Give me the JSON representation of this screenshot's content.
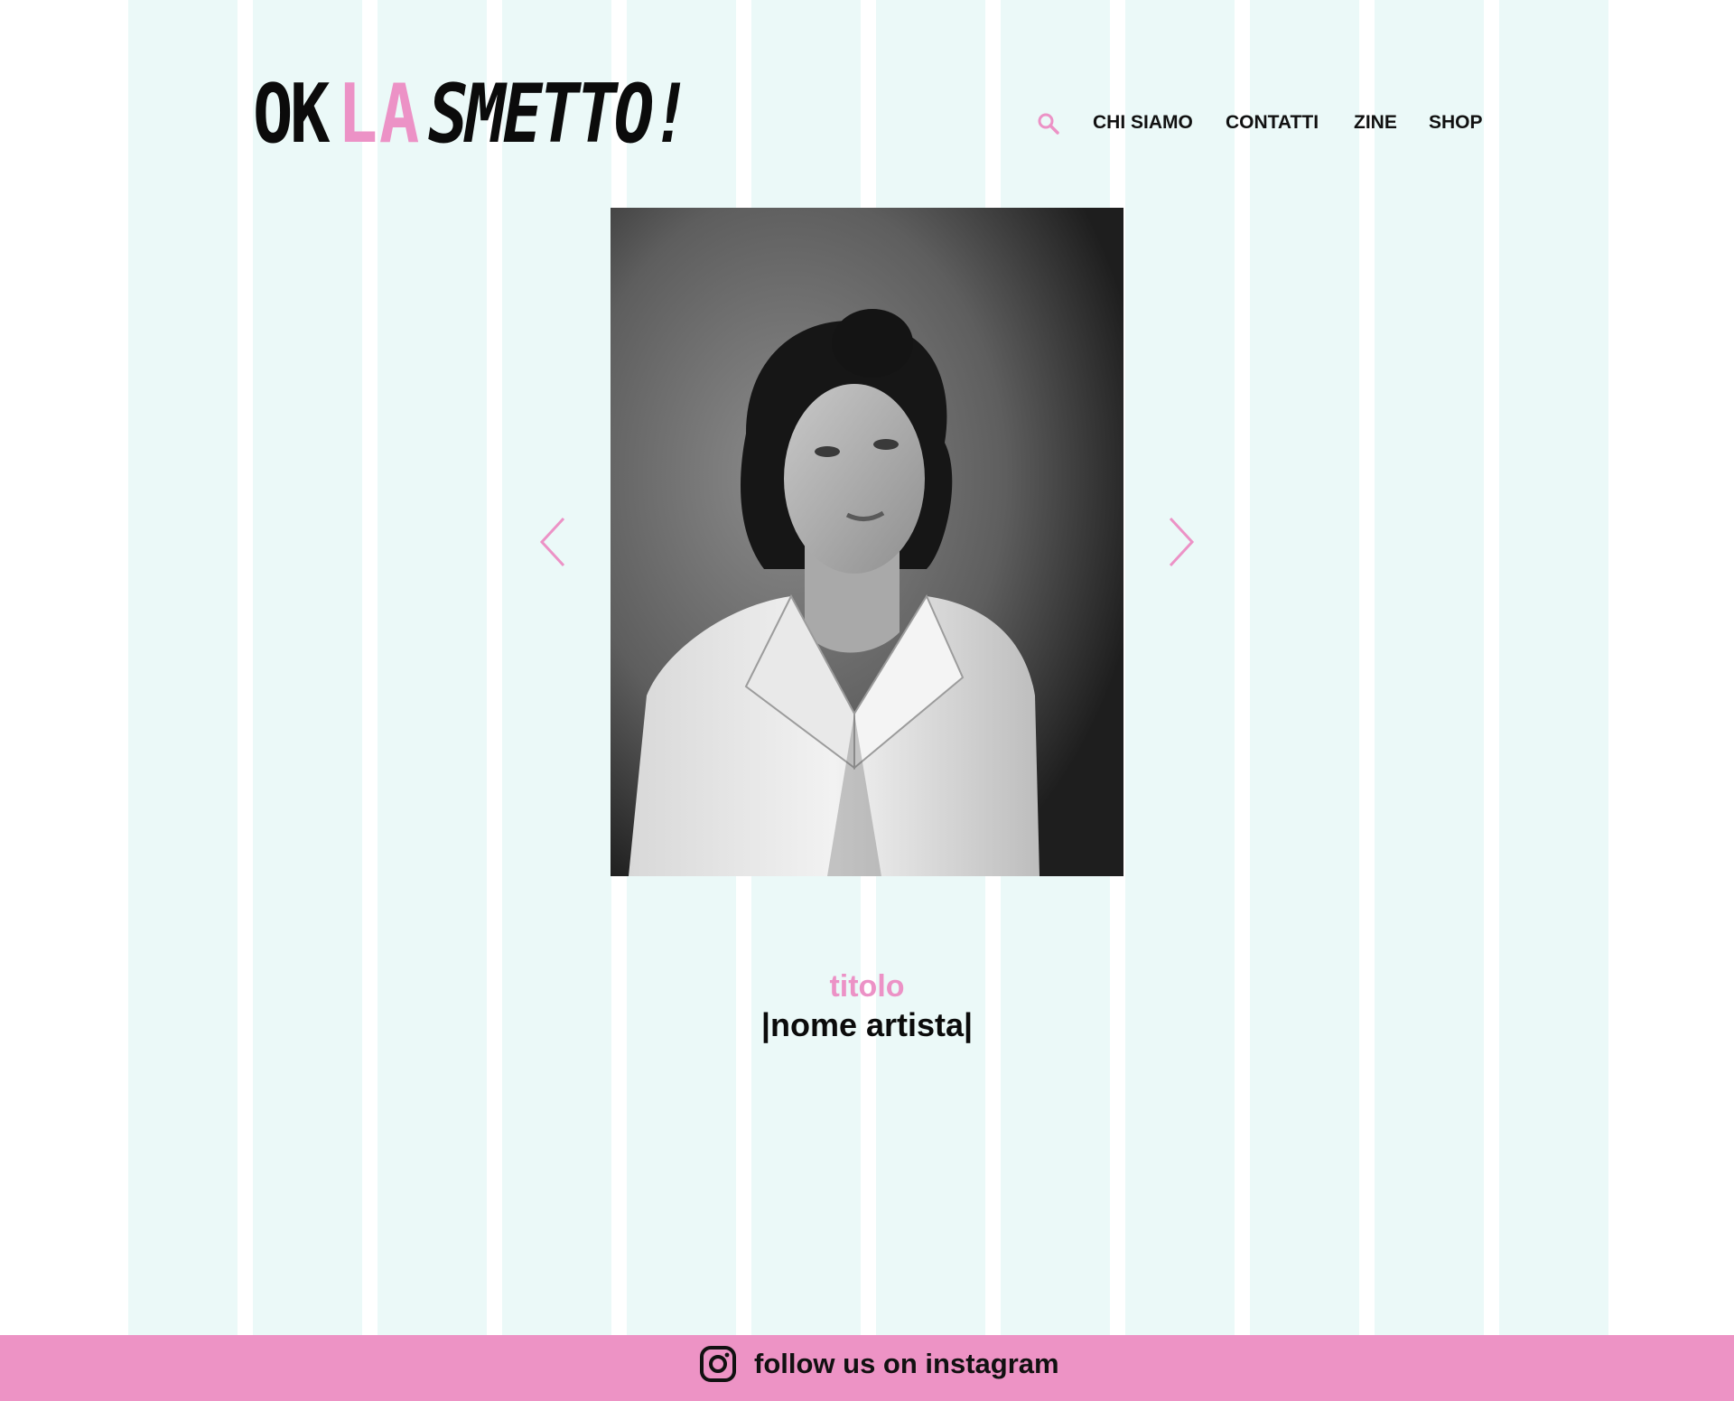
{
  "colors": {
    "accent_pink": "#ec92c6",
    "footer_pink": "#ed93c5",
    "grid_stripe": "#ebf9f8",
    "text_dark": "#111111"
  },
  "header": {
    "logo": {
      "part1": "OK",
      "part2": "LA",
      "part3": "SMETTO!"
    },
    "search_icon": "search-icon",
    "nav": [
      "CHI SIAMO",
      "CONTATTI",
      "ZINE",
      "SHOP"
    ]
  },
  "slider": {
    "image": "black-and-white portrait photograph",
    "prev_icon": "chevron-left-icon",
    "next_icon": "chevron-right-icon",
    "title": "titolo",
    "artist": "|nome artista|"
  },
  "footer": {
    "icon": "instagram-icon",
    "label": "follow us on instagram"
  }
}
